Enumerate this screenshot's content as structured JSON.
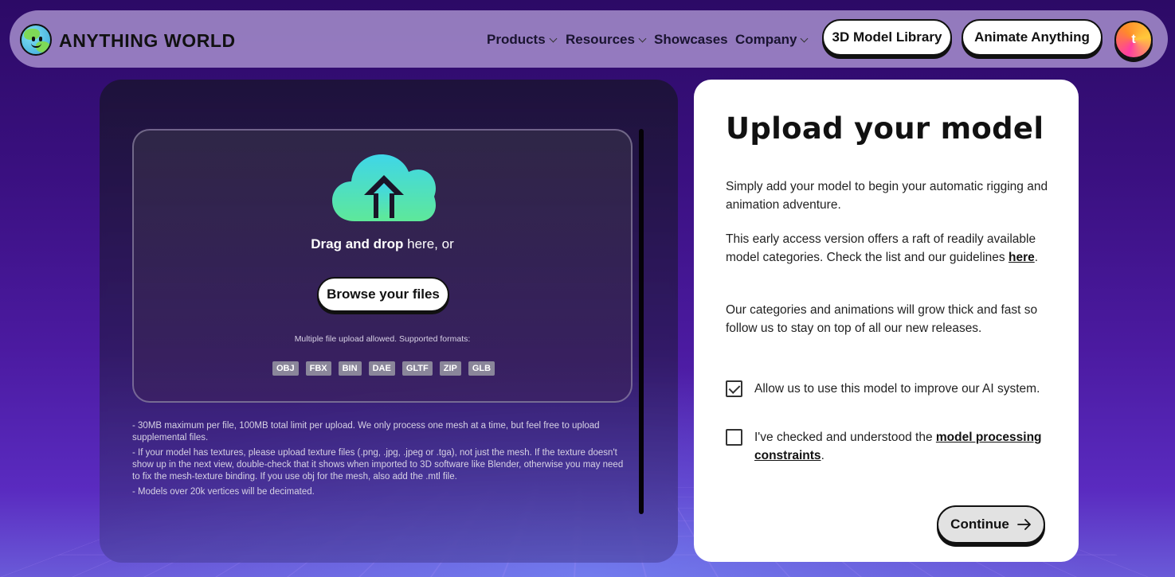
{
  "nav": {
    "brand": "ANYTHING WORLD",
    "menu": [
      {
        "label": "Products",
        "has_dropdown": true
      },
      {
        "label": "Resources",
        "has_dropdown": true
      },
      {
        "label": "Showcases",
        "has_dropdown": false
      },
      {
        "label": "Company",
        "has_dropdown": true
      }
    ],
    "library_button": "3D Model Library",
    "animate_button": "Animate Anything",
    "avatar_initial": "t"
  },
  "upload": {
    "drag_bold": "Drag and drop",
    "drag_rest": " here, or",
    "browse_button": "Browse your files",
    "formats_label": "Multiple file upload allowed. Supported formats:",
    "formats": [
      "OBJ",
      "FBX",
      "BIN",
      "DAE",
      "GLTF",
      "ZIP",
      "GLB"
    ],
    "notes": [
      "- 30MB maximum per file, 100MB total limit per upload. We only process one mesh at a time, but feel free to upload supplemental files.",
      "- If your model has textures, please upload texture files (.png, .jpg, .jpeg or .tga), not just the mesh. If the texture doesn't show up in the next view, double-check that it shows when imported to 3D software like Blender, otherwise you may need to fix the mesh-texture binding. If you use obj for the mesh, also add the .mtl file.",
      "- Models over 20k vertices will be decimated."
    ]
  },
  "card": {
    "title": "Upload your model",
    "para1": "Simply add your model to begin your automatic rigging and animation adventure.",
    "para2_text": "This early access version offers a raft of readily available model categories. Check the list and our guidelines ",
    "para2_link": "here",
    "para2_end": ".",
    "para3": "Our categories and animations will grow thick and fast so follow us to stay on top of all our new releases.",
    "check1": {
      "label": "Allow us to use this model to improve our AI system.",
      "checked": true
    },
    "check2": {
      "label_text": "I've checked and understood the ",
      "label_link": "model processing constraints",
      "label_end": ".",
      "checked": false
    },
    "continue_button": "Continue"
  },
  "colors": {
    "cloud_top": "#3fd6e8",
    "cloud_bottom": "#5ee89a",
    "background_top": "#2c0a66"
  }
}
